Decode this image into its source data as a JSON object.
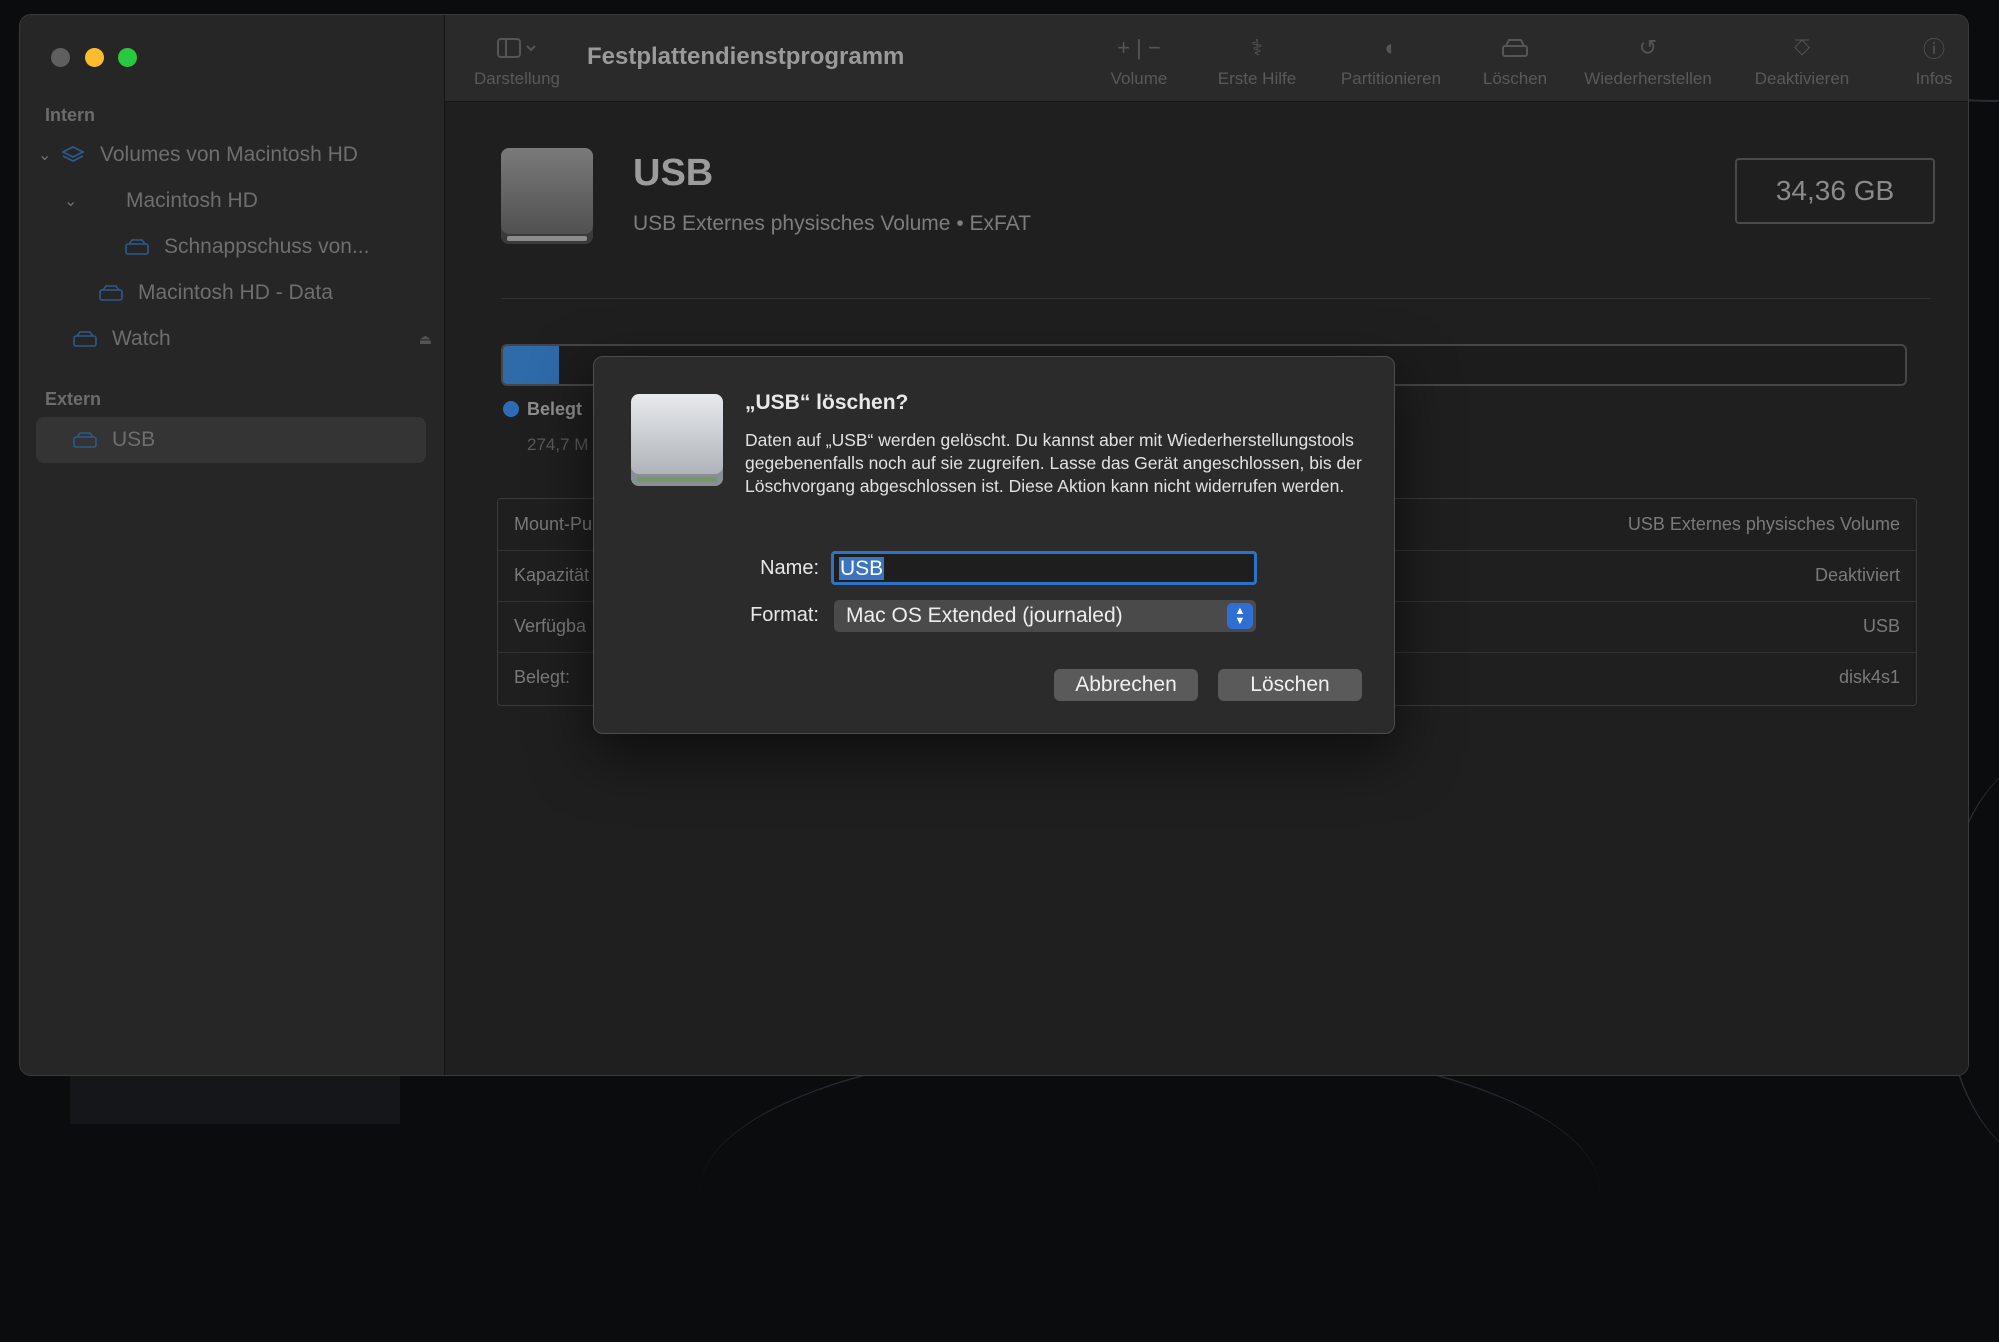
{
  "window": {
    "title": "Festplattendienstprogramm"
  },
  "sidebar": {
    "section_intern": "Intern",
    "section_extern": "Extern",
    "items": [
      {
        "label": "Volumes von Macintosh HD"
      },
      {
        "label": "Macintosh HD"
      },
      {
        "label": "Schnappschuss von..."
      },
      {
        "label": "Macintosh HD - Data"
      },
      {
        "label": "Watch"
      },
      {
        "label": "USB"
      }
    ]
  },
  "toolbar": {
    "view_label": "Darstellung",
    "volume_label": "Volume",
    "firstaid_label": "Erste Hilfe",
    "partition_label": "Partitionieren",
    "erase_label": "Löschen",
    "restore_label": "Wiederherstellen",
    "unmount_label": "Deaktivieren",
    "info_label": "Infos"
  },
  "volume": {
    "name": "USB",
    "subtitle": "USB Externes physisches Volume • ExFAT",
    "size": "34,36 GB",
    "usage_fraction": 0.008,
    "legend_label": "Belegt",
    "legend_value": "274,7 M"
  },
  "info_table": {
    "rows": [
      {
        "key": "Mount-Pu",
        "value": "USB Externes physisches Volume"
      },
      {
        "key": "Kapazität",
        "value": "Deaktiviert"
      },
      {
        "key": "Verfügba",
        "value": "USB"
      },
      {
        "key": "Belegt:",
        "value": "disk4s1"
      }
    ]
  },
  "dialog": {
    "title": "„USB“ löschen?",
    "message": "Daten auf „USB“ werden gelöscht. Du kannst aber mit Wiederherstellungstools gegebenenfalls noch auf sie zugreifen. Lasse das Gerät angeschlossen, bis der Löschvorgang abgeschlossen ist. Diese Aktion kann nicht widerrufen werden.",
    "name_label": "Name:",
    "name_value": "USB",
    "format_label": "Format:",
    "format_value": "Mac OS Extended (journaled)",
    "cancel_label": "Abbrechen",
    "erase_label": "Löschen"
  },
  "colors": {
    "accent": "#2d73c8",
    "traffic_min": "#fdbc2e",
    "traffic_max": "#28c840"
  }
}
